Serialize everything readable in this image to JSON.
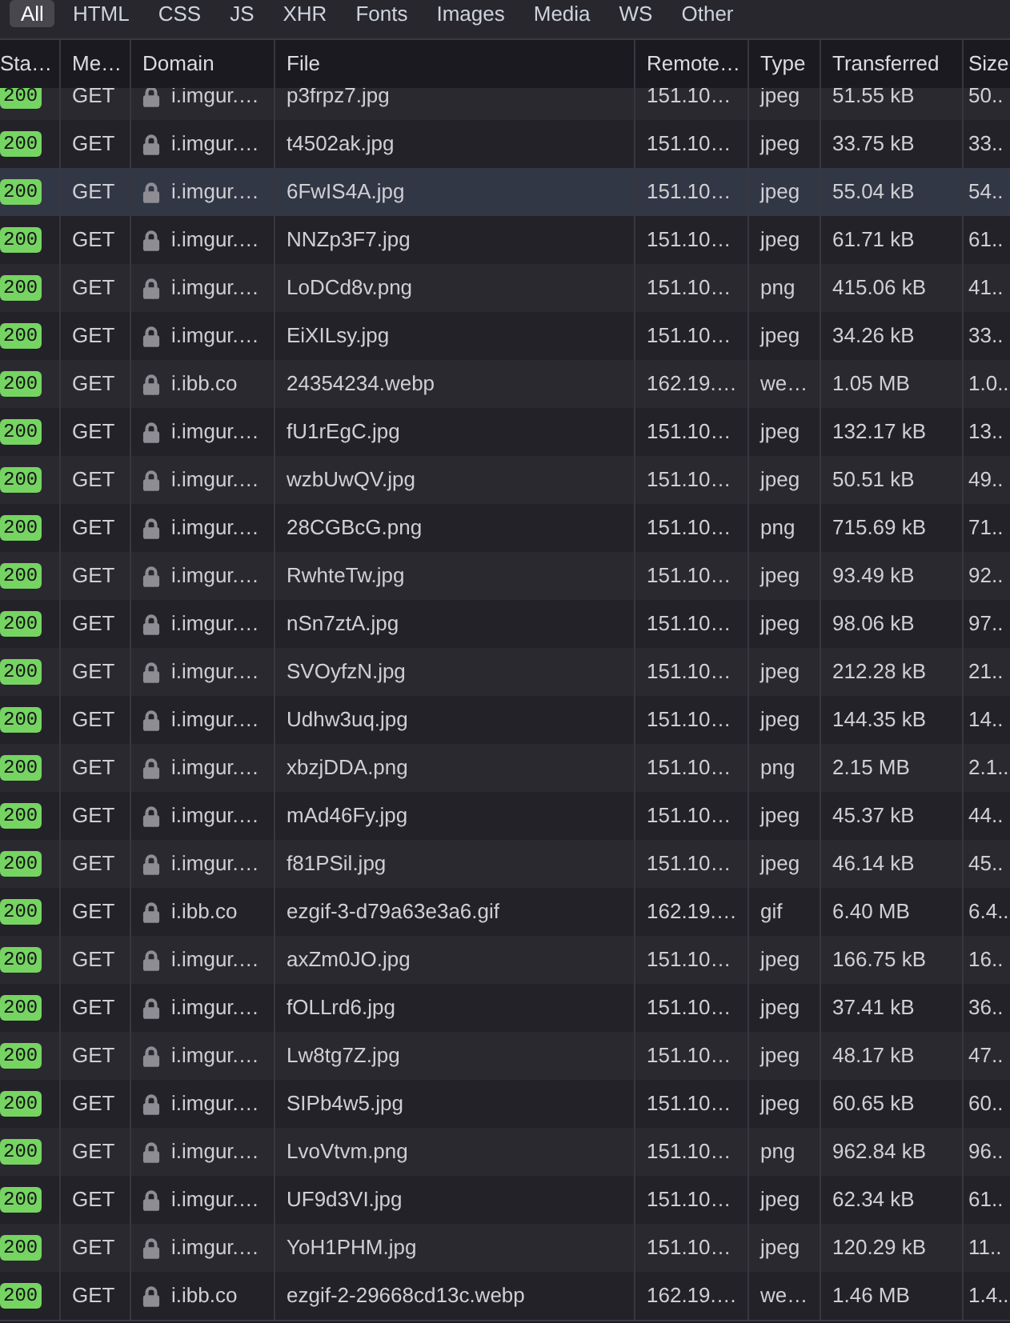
{
  "filter_tabs": [
    {
      "label": "All",
      "selected": true
    },
    {
      "label": "HTML",
      "selected": false
    },
    {
      "label": "CSS",
      "selected": false
    },
    {
      "label": "JS",
      "selected": false
    },
    {
      "label": "XHR",
      "selected": false
    },
    {
      "label": "Fonts",
      "selected": false
    },
    {
      "label": "Images",
      "selected": false
    },
    {
      "label": "Media",
      "selected": false
    },
    {
      "label": "WS",
      "selected": false
    },
    {
      "label": "Other",
      "selected": false
    }
  ],
  "table": {
    "columns": [
      "Sta…",
      "Me…",
      "Domain",
      "File",
      "Remote…",
      "Type",
      "Transferred",
      "Size"
    ],
    "rows": [
      {
        "status": "200",
        "method": "GET",
        "secure": true,
        "domain": "i.imgur.…",
        "file": "p3frpz7.jpg",
        "remote": "151.10…",
        "type": "jpeg",
        "transferred": "51.55 kB",
        "size": "50..",
        "selected": false
      },
      {
        "status": "200",
        "method": "GET",
        "secure": true,
        "domain": "i.imgur.…",
        "file": "t4502ak.jpg",
        "remote": "151.10…",
        "type": "jpeg",
        "transferred": "33.75 kB",
        "size": "33..",
        "selected": false
      },
      {
        "status": "200",
        "method": "GET",
        "secure": true,
        "domain": "i.imgur.…",
        "file": "6FwIS4A.jpg",
        "remote": "151.10…",
        "type": "jpeg",
        "transferred": "55.04 kB",
        "size": "54..",
        "selected": true
      },
      {
        "status": "200",
        "method": "GET",
        "secure": true,
        "domain": "i.imgur.…",
        "file": "NNZp3F7.jpg",
        "remote": "151.10…",
        "type": "jpeg",
        "transferred": "61.71 kB",
        "size": "61..",
        "selected": false
      },
      {
        "status": "200",
        "method": "GET",
        "secure": true,
        "domain": "i.imgur.…",
        "file": "LoDCd8v.png",
        "remote": "151.10…",
        "type": "png",
        "transferred": "415.06 kB",
        "size": "41..",
        "selected": false
      },
      {
        "status": "200",
        "method": "GET",
        "secure": true,
        "domain": "i.imgur.…",
        "file": "EiXILsy.jpg",
        "remote": "151.10…",
        "type": "jpeg",
        "transferred": "34.26 kB",
        "size": "33..",
        "selected": false
      },
      {
        "status": "200",
        "method": "GET",
        "secure": true,
        "domain": "i.ibb.co",
        "file": "24354234.webp",
        "remote": "162.19.…",
        "type": "we…",
        "transferred": "1.05 MB",
        "size": "1.0..",
        "selected": false
      },
      {
        "status": "200",
        "method": "GET",
        "secure": true,
        "domain": "i.imgur.…",
        "file": "fU1rEgC.jpg",
        "remote": "151.10…",
        "type": "jpeg",
        "transferred": "132.17 kB",
        "size": "13..",
        "selected": false
      },
      {
        "status": "200",
        "method": "GET",
        "secure": true,
        "domain": "i.imgur.…",
        "file": "wzbUwQV.jpg",
        "remote": "151.10…",
        "type": "jpeg",
        "transferred": "50.51 kB",
        "size": "49..",
        "selected": false
      },
      {
        "status": "200",
        "method": "GET",
        "secure": true,
        "domain": "i.imgur.…",
        "file": "28CGBcG.png",
        "remote": "151.10…",
        "type": "png",
        "transferred": "715.69 kB",
        "size": "71..",
        "selected": false
      },
      {
        "status": "200",
        "method": "GET",
        "secure": true,
        "domain": "i.imgur.…",
        "file": "RwhteTw.jpg",
        "remote": "151.10…",
        "type": "jpeg",
        "transferred": "93.49 kB",
        "size": "92..",
        "selected": false
      },
      {
        "status": "200",
        "method": "GET",
        "secure": true,
        "domain": "i.imgur.…",
        "file": "nSn7ztA.jpg",
        "remote": "151.10…",
        "type": "jpeg",
        "transferred": "98.06 kB",
        "size": "97..",
        "selected": false
      },
      {
        "status": "200",
        "method": "GET",
        "secure": true,
        "domain": "i.imgur.…",
        "file": "SVOyfzN.jpg",
        "remote": "151.10…",
        "type": "jpeg",
        "transferred": "212.28 kB",
        "size": "21..",
        "selected": false
      },
      {
        "status": "200",
        "method": "GET",
        "secure": true,
        "domain": "i.imgur.…",
        "file": "Udhw3uq.jpg",
        "remote": "151.10…",
        "type": "jpeg",
        "transferred": "144.35 kB",
        "size": "14..",
        "selected": false
      },
      {
        "status": "200",
        "method": "GET",
        "secure": true,
        "domain": "i.imgur.…",
        "file": "xbzjDDA.png",
        "remote": "151.10…",
        "type": "png",
        "transferred": "2.15 MB",
        "size": "2.1..",
        "selected": false
      },
      {
        "status": "200",
        "method": "GET",
        "secure": true,
        "domain": "i.imgur.…",
        "file": "mAd46Fy.jpg",
        "remote": "151.10…",
        "type": "jpeg",
        "transferred": "45.37 kB",
        "size": "44..",
        "selected": false
      },
      {
        "status": "200",
        "method": "GET",
        "secure": true,
        "domain": "i.imgur.…",
        "file": "f81PSil.jpg",
        "remote": "151.10…",
        "type": "jpeg",
        "transferred": "46.14 kB",
        "size": "45..",
        "selected": false
      },
      {
        "status": "200",
        "method": "GET",
        "secure": true,
        "domain": "i.ibb.co",
        "file": "ezgif-3-d79a63e3a6.gif",
        "remote": "162.19.…",
        "type": "gif",
        "transferred": "6.40 MB",
        "size": "6.4..",
        "selected": false
      },
      {
        "status": "200",
        "method": "GET",
        "secure": true,
        "domain": "i.imgur.…",
        "file": "axZm0JO.jpg",
        "remote": "151.10…",
        "type": "jpeg",
        "transferred": "166.75 kB",
        "size": "16..",
        "selected": false
      },
      {
        "status": "200",
        "method": "GET",
        "secure": true,
        "domain": "i.imgur.…",
        "file": "fOLLrd6.jpg",
        "remote": "151.10…",
        "type": "jpeg",
        "transferred": "37.41 kB",
        "size": "36..",
        "selected": false
      },
      {
        "status": "200",
        "method": "GET",
        "secure": true,
        "domain": "i.imgur.…",
        "file": "Lw8tg7Z.jpg",
        "remote": "151.10…",
        "type": "jpeg",
        "transferred": "48.17 kB",
        "size": "47..",
        "selected": false
      },
      {
        "status": "200",
        "method": "GET",
        "secure": true,
        "domain": "i.imgur.…",
        "file": "SIPb4w5.jpg",
        "remote": "151.10…",
        "type": "jpeg",
        "transferred": "60.65 kB",
        "size": "60..",
        "selected": false
      },
      {
        "status": "200",
        "method": "GET",
        "secure": true,
        "domain": "i.imgur.…",
        "file": "LvoVtvm.png",
        "remote": "151.10…",
        "type": "png",
        "transferred": "962.84 kB",
        "size": "96..",
        "selected": false
      },
      {
        "status": "200",
        "method": "GET",
        "secure": true,
        "domain": "i.imgur.…",
        "file": "UF9d3VI.jpg",
        "remote": "151.10…",
        "type": "jpeg",
        "transferred": "62.34 kB",
        "size": "61..",
        "selected": false
      },
      {
        "status": "200",
        "method": "GET",
        "secure": true,
        "domain": "i.imgur.…",
        "file": "YoH1PHM.jpg",
        "remote": "151.10…",
        "type": "jpeg",
        "transferred": "120.29 kB",
        "size": "11..",
        "selected": false
      },
      {
        "status": "200",
        "method": "GET",
        "secure": true,
        "domain": "i.ibb.co",
        "file": "ezgif-2-29668cd13c.webp",
        "remote": "162.19.…",
        "type": "we…",
        "transferred": "1.46 MB",
        "size": "1.4..",
        "selected": false
      }
    ]
  }
}
